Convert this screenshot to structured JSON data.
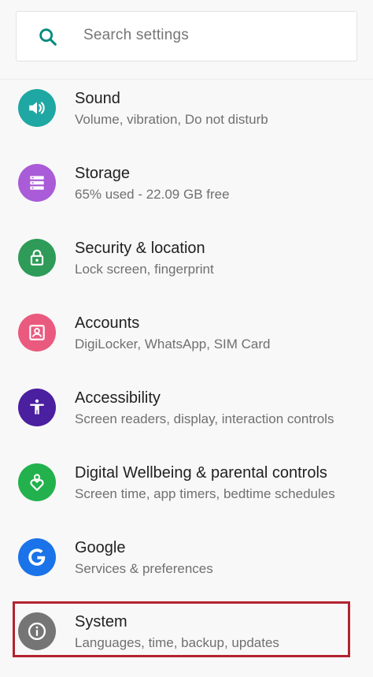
{
  "search": {
    "placeholder": "Search settings"
  },
  "items": [
    {
      "title": "Sound",
      "subtitle": "Volume, vibration, Do not disturb",
      "icon": "volume-icon",
      "color": "#1fa7a3"
    },
    {
      "title": "Storage",
      "subtitle": "65% used - 22.09 GB free",
      "icon": "storage-icon",
      "color": "#a95bd8"
    },
    {
      "title": "Security & location",
      "subtitle": "Lock screen, fingerprint",
      "icon": "lock-icon",
      "color": "#2e9b58"
    },
    {
      "title": "Accounts",
      "subtitle": "DigiLocker, WhatsApp, SIM Card",
      "icon": "account-icon",
      "color": "#ea5a7e"
    },
    {
      "title": "Accessibility",
      "subtitle": "Screen readers, display, interaction controls",
      "icon": "accessibility-icon",
      "color": "#4a1fa0"
    },
    {
      "title": "Digital Wellbeing & parental controls",
      "subtitle": "Screen time, app timers, bedtime schedules",
      "icon": "wellbeing-icon",
      "color": "#22b14c"
    },
    {
      "title": "Google",
      "subtitle": "Services & preferences",
      "icon": "google-icon",
      "color": "#1a73e8"
    },
    {
      "title": "System",
      "subtitle": "Languages, time, backup, updates",
      "icon": "info-icon",
      "color": "#757575"
    }
  ],
  "colors": {
    "highlight_border": "#b3232f",
    "search_icon": "#00897b"
  }
}
